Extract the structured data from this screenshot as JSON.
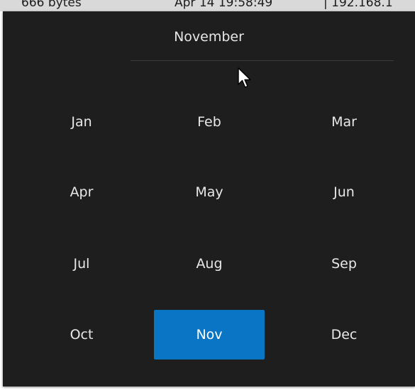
{
  "background_row": {
    "col1": "666 bytes",
    "col2": "Apr 14 19:58:49",
    "col3": "| 192.168.1"
  },
  "picker": {
    "header_title": "November",
    "months": [
      {
        "label": "Jan",
        "selected": false
      },
      {
        "label": "Feb",
        "selected": false
      },
      {
        "label": "Mar",
        "selected": false
      },
      {
        "label": "Apr",
        "selected": false
      },
      {
        "label": "May",
        "selected": false
      },
      {
        "label": "Jun",
        "selected": false
      },
      {
        "label": "Jul",
        "selected": false
      },
      {
        "label": "Aug",
        "selected": false
      },
      {
        "label": "Sep",
        "selected": false
      },
      {
        "label": "Oct",
        "selected": false
      },
      {
        "label": "Nov",
        "selected": true
      },
      {
        "label": "Dec",
        "selected": false
      }
    ]
  },
  "colors": {
    "background": "#1e1e1e",
    "selected": "#0a75c4",
    "text": "#e8e8e8"
  },
  "icons": {
    "cursor": "mouse-pointer-icon"
  }
}
